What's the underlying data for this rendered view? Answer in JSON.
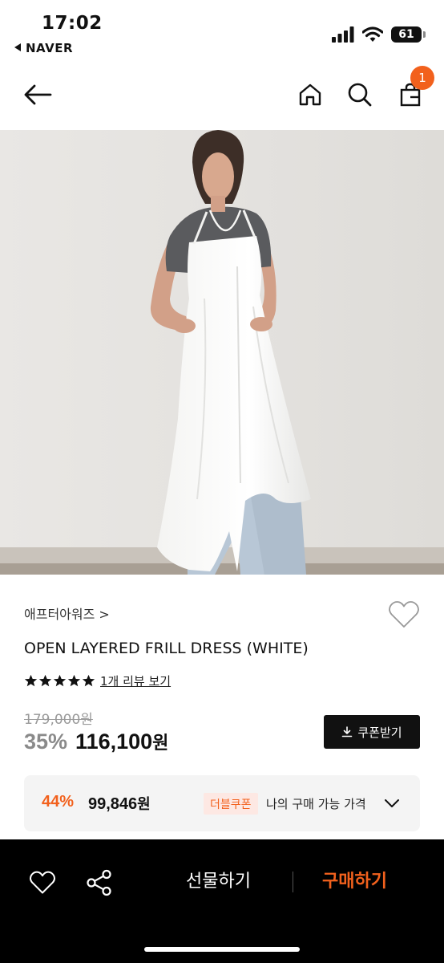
{
  "status_bar": {
    "time": "17:02",
    "back_app": "NAVER",
    "battery": "61"
  },
  "header": {
    "cart_count": "1",
    "icons": [
      "back-arrow-icon",
      "home-icon",
      "search-icon",
      "cart-icon"
    ]
  },
  "product": {
    "brand": "애프터아워즈 >",
    "name": "OPEN LAYERED FRILL DRESS (WHITE)",
    "rating": 5,
    "review_link": "1개 리뷰 보기",
    "original_price": "179,000원",
    "discount": "35%",
    "sale_price": "116,100",
    "currency": "원",
    "coupon_button": "쿠폰받기"
  },
  "benefit": {
    "discount": "44%",
    "price": "99,846",
    "currency": "원",
    "coupon_tag": "더블쿠폰",
    "label": "나의 구매 가능 가격"
  },
  "bottom_bar": {
    "gift_label": "선물하기",
    "buy_label": "구매하기"
  },
  "colors": {
    "accent": "#f2611d",
    "bottom_bar": "#000000"
  }
}
